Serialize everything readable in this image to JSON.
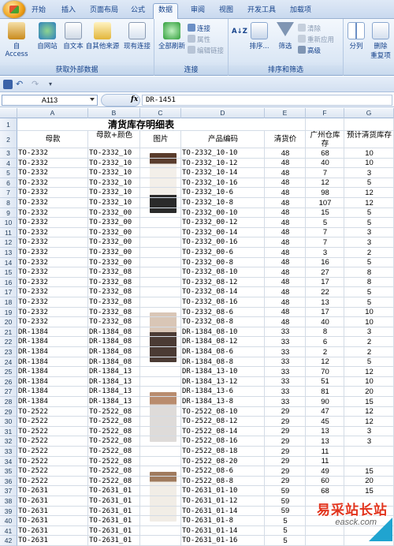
{
  "ribbon_tabs": [
    "开始",
    "插入",
    "页面布局",
    "公式",
    "数据",
    "审阅",
    "视图",
    "开发工具",
    "加载项"
  ],
  "active_tab": "数据",
  "ribbon": {
    "get_external": {
      "label": "获取外部数据",
      "buttons": [
        "自 Access",
        "自网站",
        "自文本",
        "自其他来源",
        "现有连接"
      ]
    },
    "connections": {
      "label": "连接",
      "refresh_all": "全部刷新",
      "small": [
        "连接",
        "属性",
        "编辑链接"
      ]
    },
    "sort_filter": {
      "label": "排序和筛选",
      "sort": "排序...",
      "filter": "筛选",
      "small": [
        "清除",
        "重新应用",
        "高级"
      ]
    },
    "data_tools": {
      "buttons": [
        "分列",
        "删除",
        "重复项"
      ]
    }
  },
  "formula_bar": {
    "name_box": "A113",
    "fx": "fx",
    "value": "DR-1451"
  },
  "columns": [
    "A",
    "B",
    "C",
    "D",
    "E",
    "F",
    "G"
  ],
  "sheet": {
    "title": "清货库存明细表",
    "headers": [
      "母款",
      "母款+颜色",
      "图片",
      "产品编码",
      "清货价",
      "广州仓库存",
      "预计清货库存"
    ],
    "rows": [
      {
        "n": "3",
        "a": "TO-2332",
        "b": "TO-2332_10",
        "d": "TO-2332_10-10",
        "e": "48",
        "f": "68",
        "g": "10"
      },
      {
        "n": "4",
        "a": "TO-2332",
        "b": "TO-2332_10",
        "d": "TO-2332_10-12",
        "e": "48",
        "f": "40",
        "g": "10"
      },
      {
        "n": "5",
        "a": "TO-2332",
        "b": "TO-2332_10",
        "d": "TO-2332_10-14",
        "e": "48",
        "f": "7",
        "g": "3"
      },
      {
        "n": "6",
        "a": "TO-2332",
        "b": "TO-2332_10",
        "d": "TO-2332_10-16",
        "e": "48",
        "f": "12",
        "g": "5"
      },
      {
        "n": "7",
        "a": "TO-2332",
        "b": "TO-2332_10",
        "d": "TO-2332_10-6",
        "e": "48",
        "f": "98",
        "g": "12"
      },
      {
        "n": "8",
        "a": "TO-2332",
        "b": "TO-2332_10",
        "d": "TO-2332_10-8",
        "e": "48",
        "f": "107",
        "g": "12"
      },
      {
        "n": "9",
        "a": "TO-2332",
        "b": "TO-2332_00",
        "d": "TO-2332_00-10",
        "e": "48",
        "f": "15",
        "g": "5"
      },
      {
        "n": "10",
        "a": "TO-2332",
        "b": "TO-2332_00",
        "d": "TO-2332_00-12",
        "e": "48",
        "f": "5",
        "g": "5"
      },
      {
        "n": "11",
        "a": "TO-2332",
        "b": "TO-2332_00",
        "d": "TO-2332_00-14",
        "e": "48",
        "f": "7",
        "g": "3"
      },
      {
        "n": "12",
        "a": "TO-2332",
        "b": "TO-2332_00",
        "d": "TO-2332_00-16",
        "e": "48",
        "f": "7",
        "g": "3"
      },
      {
        "n": "13",
        "a": "TO-2332",
        "b": "TO-2332_00",
        "d": "TO-2332_00-6",
        "e": "48",
        "f": "3",
        "g": "2"
      },
      {
        "n": "14",
        "a": "TO-2332",
        "b": "TO-2332_00",
        "d": "TO-2332_00-8",
        "e": "48",
        "f": "16",
        "g": "5"
      },
      {
        "n": "15",
        "a": "TO-2332",
        "b": "TO-2332_08",
        "d": "TO-2332_08-10",
        "e": "48",
        "f": "27",
        "g": "8"
      },
      {
        "n": "16",
        "a": "TO-2332",
        "b": "TO-2332_08",
        "d": "TO-2332_08-12",
        "e": "48",
        "f": "17",
        "g": "8"
      },
      {
        "n": "17",
        "a": "TO-2332",
        "b": "TO-2332_08",
        "d": "TO-2332_08-14",
        "e": "48",
        "f": "22",
        "g": "5"
      },
      {
        "n": "18",
        "a": "TO-2332",
        "b": "TO-2332_08",
        "d": "TO-2332_08-16",
        "e": "48",
        "f": "13",
        "g": "5"
      },
      {
        "n": "19",
        "a": "TO-2332",
        "b": "TO-2332_08",
        "d": "TO-2332_08-6",
        "e": "48",
        "f": "17",
        "g": "10"
      },
      {
        "n": "20",
        "a": "TO-2332",
        "b": "TO-2332_08",
        "d": "TO-2332_08-8",
        "e": "48",
        "f": "40",
        "g": "10"
      },
      {
        "n": "21",
        "a": "DR-1384",
        "b": "DR-1384_08",
        "d": "DR-1384_08-10",
        "e": "33",
        "f": "8",
        "g": "3"
      },
      {
        "n": "22",
        "a": "DR-1384",
        "b": "DR-1384_08",
        "d": "DR-1384_08-12",
        "e": "33",
        "f": "6",
        "g": "2"
      },
      {
        "n": "23",
        "a": "DR-1384",
        "b": "DR-1384_08",
        "d": "DR-1384_08-6",
        "e": "33",
        "f": "2",
        "g": "2"
      },
      {
        "n": "24",
        "a": "DR-1384",
        "b": "DR-1384_08",
        "d": "DR-1384_08-8",
        "e": "33",
        "f": "12",
        "g": "5"
      },
      {
        "n": "25",
        "a": "DR-1384",
        "b": "DR-1384_13",
        "d": "DR-1384_13-10",
        "e": "33",
        "f": "70",
        "g": "12"
      },
      {
        "n": "26",
        "a": "DR-1384",
        "b": "DR-1384_13",
        "d": "DR-1384_13-12",
        "e": "33",
        "f": "51",
        "g": "10"
      },
      {
        "n": "27",
        "a": "DR-1384",
        "b": "DR-1384_13",
        "d": "DR-1384_13-6",
        "e": "33",
        "f": "81",
        "g": "20"
      },
      {
        "n": "28",
        "a": "DR-1384",
        "b": "DR-1384_13",
        "d": "DR-1384_13-8",
        "e": "33",
        "f": "90",
        "g": "15"
      },
      {
        "n": "29",
        "a": "TO-2522",
        "b": "TO-2522_08",
        "d": "TO-2522_08-10",
        "e": "29",
        "f": "47",
        "g": "12"
      },
      {
        "n": "30",
        "a": "TO-2522",
        "b": "TO-2522_08",
        "d": "TO-2522_08-12",
        "e": "29",
        "f": "45",
        "g": "12"
      },
      {
        "n": "31",
        "a": "TO-2522",
        "b": "TO-2522_08",
        "d": "TO-2522_08-14",
        "e": "29",
        "f": "13",
        "g": "3"
      },
      {
        "n": "32",
        "a": "TO-2522",
        "b": "TO-2522_08",
        "d": "TO-2522_08-16",
        "e": "29",
        "f": "13",
        "g": "3"
      },
      {
        "n": "33",
        "a": "TO-2522",
        "b": "TO-2522_08",
        "d": "TO-2522_08-18",
        "e": "29",
        "f": "11",
        "g": ""
      },
      {
        "n": "34",
        "a": "TO-2522",
        "b": "TO-2522_08",
        "d": "TO-2522_08-20",
        "e": "29",
        "f": "11",
        "g": ""
      },
      {
        "n": "35",
        "a": "TO-2522",
        "b": "TO-2522_08",
        "d": "TO-2522_08-6",
        "e": "29",
        "f": "49",
        "g": "15"
      },
      {
        "n": "36",
        "a": "TO-2522",
        "b": "TO-2522_08",
        "d": "TO-2522_08-8",
        "e": "29",
        "f": "60",
        "g": "20"
      },
      {
        "n": "37",
        "a": "TO-2631",
        "b": "TO-2631_01",
        "d": "TO-2631_01-10",
        "e": "59",
        "f": "68",
        "g": "15"
      },
      {
        "n": "38",
        "a": "TO-2631",
        "b": "TO-2631_01",
        "d": "TO-2631_01-12",
        "e": "59",
        "f": "",
        "g": ""
      },
      {
        "n": "39",
        "a": "TO-2631",
        "b": "TO-2631_01",
        "d": "TO-2631_01-14",
        "e": "59",
        "f": "",
        "g": ""
      },
      {
        "n": "40",
        "a": "TO-2631",
        "b": "TO-2631_01",
        "d": "TO-2631_01-8",
        "e": "5",
        "f": "",
        "g": ""
      },
      {
        "n": "41",
        "a": "TO-2631",
        "b": "TO-2631_01",
        "d": "TO-2631_01-14",
        "e": "5",
        "f": "",
        "g": ""
      },
      {
        "n": "42",
        "a": "TO-2631",
        "b": "TO-2631_01",
        "d": "TO-2631_01-16",
        "e": "5",
        "f": "",
        "g": ""
      }
    ]
  },
  "watermark": {
    "text": "易采站长站",
    "sub": "easck.com",
    "color": "#e2341d"
  }
}
